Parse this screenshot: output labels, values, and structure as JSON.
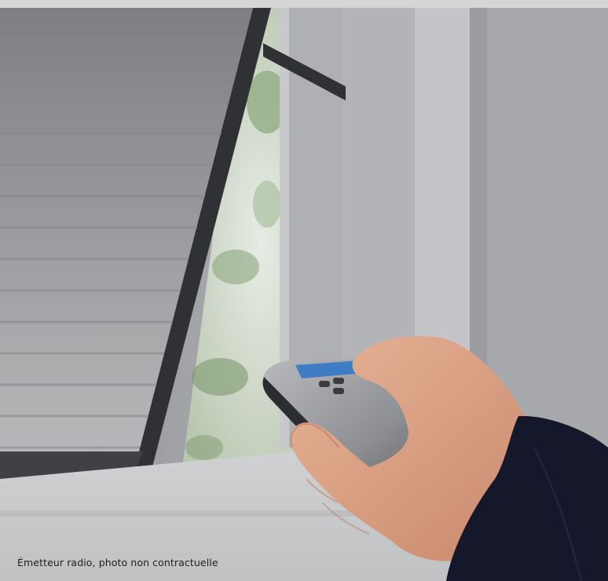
{
  "caption": {
    "text": "Émetteur radio, photo non contractuelle"
  },
  "colors": {
    "blind": "#9a9c9f",
    "frame_dark": "#3a3c40",
    "wall": "#a9abae",
    "foliage": "#7f9a70",
    "sleeve": "#15182a",
    "skin": "#d9a183",
    "remote": "#8f9194",
    "remote_screen": "#3e7cc4"
  },
  "icons": {
    "photo": "photo-of-remote-control-window-shutter"
  }
}
